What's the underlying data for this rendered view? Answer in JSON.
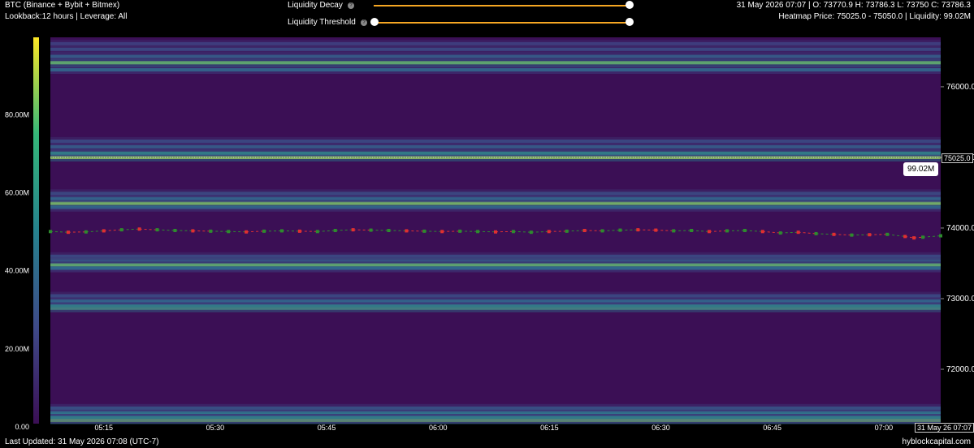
{
  "header": {
    "title": "BTC (Binance + Bybit + Bitmex)",
    "subtitle": "Lookback:12 hours | Leverage: All",
    "ohlc": "31 May 2026 07:07 | O: 73770.9 H: 73786.3 L: 73750 C: 73786.3",
    "heatmap_info": "Heatmap Price: 75025.0 - 75050.0 | Liquidity: 99.02M"
  },
  "controls": {
    "liquidity_decay_label": "Liquidity Decay",
    "liquidity_threshold_label": "Liquidity Threshold",
    "decay_value": 1.0,
    "threshold_range": [
      0.0,
      1.0
    ]
  },
  "footer": {
    "last_updated": "Last Updated: 31 May 2026 07:08 (UTC-7)",
    "brand": "hyblockcapital.com"
  },
  "tooltip": {
    "value": "99.02M",
    "price_tag": "75025.0",
    "time_tag": "31 May 26 07:07"
  },
  "colors": {
    "background": "#000000",
    "heat_low": "#3b0f55",
    "accent": "#f5a623",
    "candle_up": "#2e8b2e",
    "candle_down": "#e03030"
  },
  "chart_data": {
    "type": "heatmap",
    "x_ticks": [
      "05:15",
      "05:30",
      "05:45",
      "06:00",
      "06:15",
      "06:30",
      "06:45",
      "07:00"
    ],
    "y_ticks": [
      "72000.0",
      "73000.0",
      "74000.0",
      "75000.0",
      "76000.0"
    ],
    "y_tick_values": [
      72000,
      73000,
      74000,
      75000,
      76000
    ],
    "ylim": [
      71230,
      76700
    ],
    "colorbar_ticks": [
      "0.00",
      "20.00M",
      "40.00M",
      "60.00M",
      "80.00M"
    ],
    "colorbar_values": [
      0,
      20,
      40,
      60,
      80
    ],
    "colorbar_range": [
      0,
      99
    ],
    "bands": [
      {
        "price": 71280,
        "intensity": 0.9
      },
      {
        "price": 71320,
        "intensity": 0.6
      },
      {
        "price": 71390,
        "intensity": 0.55
      },
      {
        "price": 71450,
        "intensity": 0.35
      },
      {
        "price": 72865,
        "intensity": 0.8
      },
      {
        "price": 72900,
        "intensity": 0.6
      },
      {
        "price": 72970,
        "intensity": 0.45
      },
      {
        "price": 73040,
        "intensity": 0.3
      },
      {
        "price": 73430,
        "intensity": 0.45
      },
      {
        "price": 73480,
        "intensity": 0.85
      },
      {
        "price": 73550,
        "intensity": 0.4
      },
      {
        "price": 73600,
        "intensity": 0.3
      },
      {
        "price": 74290,
        "intensity": 0.4
      },
      {
        "price": 74350,
        "intensity": 0.9
      },
      {
        "price": 74420,
        "intensity": 0.45
      },
      {
        "price": 74490,
        "intensity": 0.3
      },
      {
        "price": 75000,
        "intensity": 0.95
      },
      {
        "price": 75060,
        "intensity": 0.6
      },
      {
        "price": 75150,
        "intensity": 0.4
      },
      {
        "price": 75230,
        "intensity": 0.3
      },
      {
        "price": 76240,
        "intensity": 0.45
      },
      {
        "price": 76340,
        "intensity": 0.85
      },
      {
        "price": 76430,
        "intensity": 0.4
      },
      {
        "price": 76530,
        "intensity": 0.3
      },
      {
        "price": 76610,
        "intensity": 0.25
      }
    ],
    "price_series": [
      [
        0.0,
        73950,
        0
      ],
      [
        0.02,
        73940,
        1
      ],
      [
        0.04,
        73945,
        0
      ],
      [
        0.06,
        73960,
        1
      ],
      [
        0.08,
        73975,
        0
      ],
      [
        0.1,
        73985,
        1
      ],
      [
        0.12,
        73975,
        0
      ],
      [
        0.14,
        73965,
        0
      ],
      [
        0.16,
        73960,
        1
      ],
      [
        0.18,
        73955,
        0
      ],
      [
        0.2,
        73950,
        0
      ],
      [
        0.22,
        73945,
        1
      ],
      [
        0.24,
        73955,
        0
      ],
      [
        0.26,
        73960,
        0
      ],
      [
        0.28,
        73955,
        1
      ],
      [
        0.3,
        73950,
        0
      ],
      [
        0.32,
        73965,
        0
      ],
      [
        0.34,
        73975,
        1
      ],
      [
        0.36,
        73970,
        0
      ],
      [
        0.38,
        73965,
        0
      ],
      [
        0.4,
        73960,
        1
      ],
      [
        0.42,
        73955,
        0
      ],
      [
        0.44,
        73950,
        1
      ],
      [
        0.46,
        73955,
        0
      ],
      [
        0.48,
        73950,
        0
      ],
      [
        0.5,
        73945,
        1
      ],
      [
        0.52,
        73950,
        0
      ],
      [
        0.54,
        73940,
        0
      ],
      [
        0.56,
        73950,
        1
      ],
      [
        0.58,
        73955,
        0
      ],
      [
        0.6,
        73965,
        1
      ],
      [
        0.62,
        73960,
        0
      ],
      [
        0.64,
        73970,
        0
      ],
      [
        0.66,
        73975,
        1
      ],
      [
        0.68,
        73970,
        1
      ],
      [
        0.7,
        73960,
        0
      ],
      [
        0.72,
        73965,
        0
      ],
      [
        0.74,
        73950,
        1
      ],
      [
        0.76,
        73960,
        0
      ],
      [
        0.78,
        73965,
        0
      ],
      [
        0.8,
        73950,
        1
      ],
      [
        0.82,
        73930,
        0
      ],
      [
        0.84,
        73940,
        1
      ],
      [
        0.86,
        73920,
        0
      ],
      [
        0.88,
        73910,
        1
      ],
      [
        0.9,
        73900,
        0
      ],
      [
        0.92,
        73905,
        1
      ],
      [
        0.94,
        73910,
        0
      ],
      [
        0.96,
        73880,
        1
      ],
      [
        0.97,
        73860,
        1
      ],
      [
        0.98,
        73870,
        0
      ],
      [
        1.0,
        73890,
        0
      ]
    ]
  }
}
